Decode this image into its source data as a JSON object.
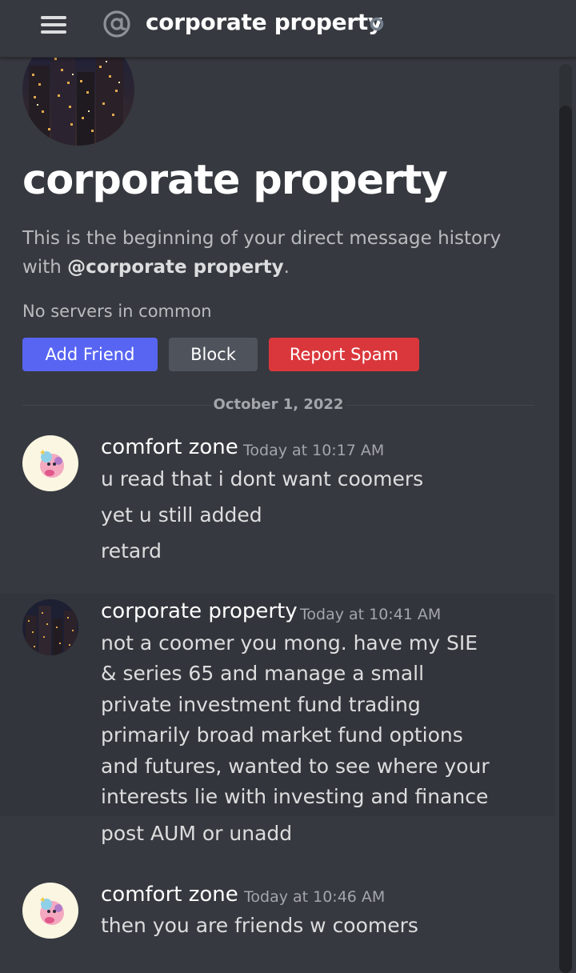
{
  "header": {
    "title": "corporate property",
    "menu_icon": "hamburger-menu-icon",
    "at_icon": "at-sign-icon",
    "status_icon": "offline-status-icon"
  },
  "intro": {
    "title": "corporate property",
    "description_prefix": "This is the beginning of your direct message history with ",
    "description_handle": "@corporate property",
    "description_suffix": ".",
    "no_servers": "No servers in common",
    "buttons": {
      "add_friend": "Add Friend",
      "block": "Block",
      "report_spam": "Report Spam"
    }
  },
  "divider": {
    "date": "October 1, 2022"
  },
  "messages": [
    {
      "author": "comfort zone",
      "time": "Today at 10:17 AM",
      "lines": [
        "u read that i dont want coomers",
        "yet u still added",
        "retard"
      ]
    },
    {
      "author": "corporate property",
      "time": "Today at 10:41 AM",
      "lines": [
        "not a coomer you mong. have my SIE",
        "& series 65 and manage a small",
        "private investment fund trading",
        "primarily broad market fund options",
        "and futures, wanted to see where your",
        "interests lie with investing and finance",
        "post AUM or unadd"
      ]
    },
    {
      "author": "comfort zone",
      "time": "Today at 10:46 AM",
      "lines": [
        "then you are friends w coomers"
      ]
    }
  ],
  "colors": {
    "background": "#36393f",
    "blurple": "#5865f2",
    "block_gray": "#4f545c",
    "danger_red": "#da373c",
    "muted_text": "#b9bbbe"
  }
}
